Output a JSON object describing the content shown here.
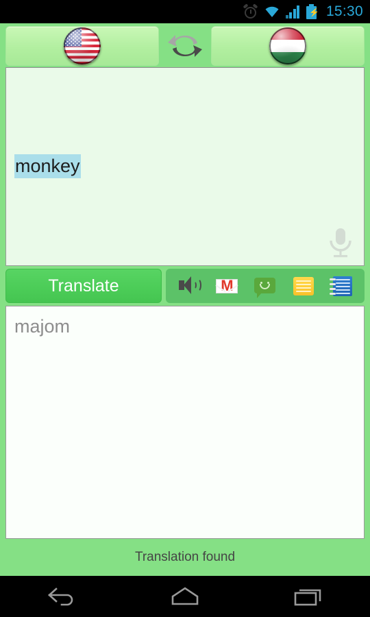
{
  "status_bar": {
    "time": "15:30",
    "icons": [
      "alarm-clock-icon",
      "wifi-icon",
      "signal-icon",
      "battery-charging-icon"
    ],
    "accent_color": "#2aa8d8",
    "background": "#000000"
  },
  "app": {
    "background": "#85e085",
    "language_bar": {
      "source_language": {
        "name": "United States",
        "flag": "us-flag-icon",
        "colors": [
          "#d9283c",
          "#ffffff",
          "#2a3a8c"
        ]
      },
      "swap": {
        "icon": "swap-languages-icon",
        "arrow_top_color": "#a8a8a8",
        "arrow_bottom_color": "#4a4a4a"
      },
      "target_language": {
        "name": "Hungary",
        "flag": "hu-flag-icon",
        "colors": [
          "#cd2a3e",
          "#ffffff",
          "#2f8a4e"
        ]
      },
      "button_background": "#b2efa0"
    },
    "input_area": {
      "text": "monkey",
      "selected": true,
      "selection_color": "#aadeea",
      "text_color": "#1d1d1d",
      "background": "#eafae9",
      "mic_icon": "microphone-icon",
      "placeholder": ""
    },
    "actions": {
      "translate_label": "Translate",
      "translate_color": "#4bcc57",
      "panel_background": "#5cc268",
      "icons": [
        {
          "name": "speak-icon",
          "label": "Speak"
        },
        {
          "name": "gmail-icon",
          "label": "Gmail"
        },
        {
          "name": "sms-icon",
          "label": "SMS"
        },
        {
          "name": "notes-icon",
          "label": "Notes"
        },
        {
          "name": "dictionary-icon",
          "label": "Dictionary"
        }
      ]
    },
    "output_area": {
      "text": "majom",
      "text_color": "#8d8d8d",
      "background": "#fbfffb",
      "placeholder": ""
    },
    "status_message": "Translation found"
  },
  "nav_bar": {
    "background": "#000000",
    "buttons": [
      {
        "name": "back-button",
        "icon": "back-arrow-icon"
      },
      {
        "name": "home-button",
        "icon": "home-icon"
      },
      {
        "name": "recents-button",
        "icon": "recents-icon"
      }
    ]
  }
}
